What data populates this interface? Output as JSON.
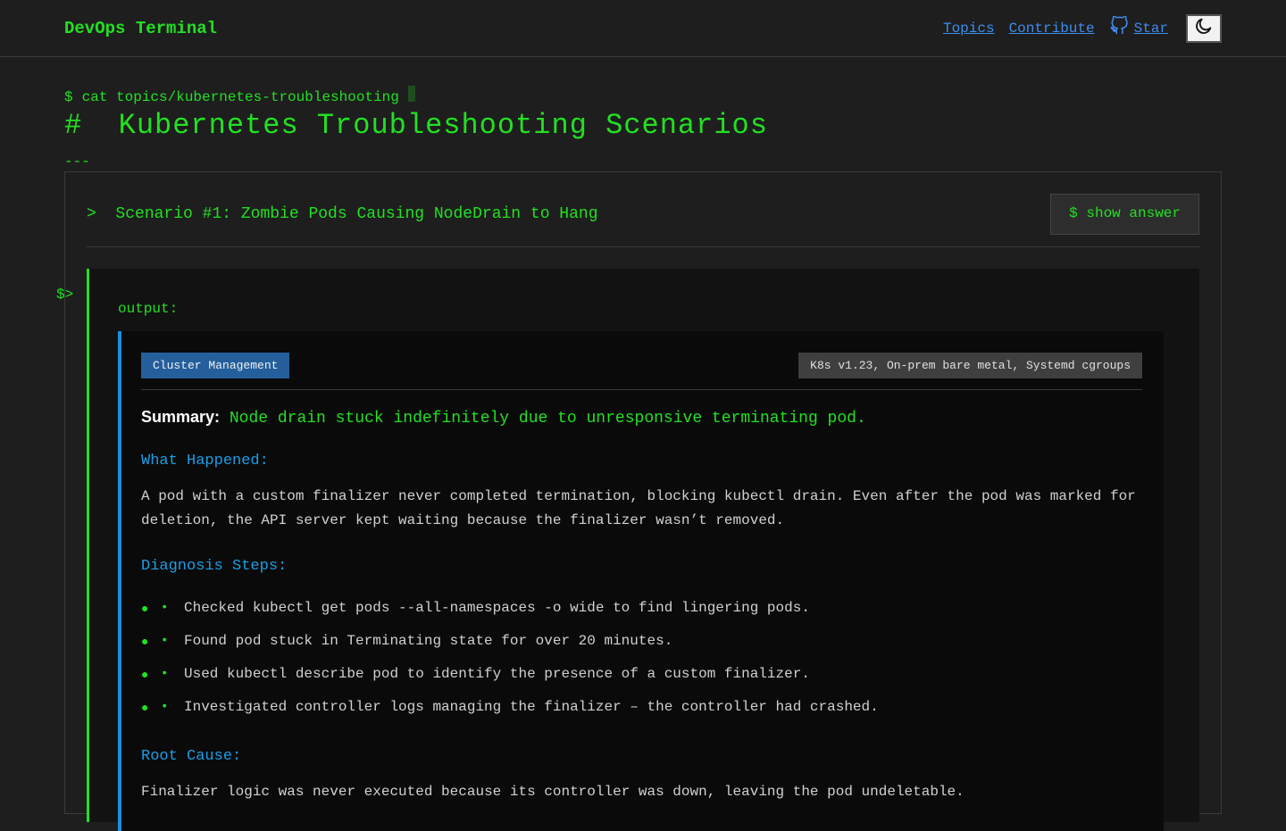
{
  "header": {
    "brand": "DevOps Terminal",
    "nav": {
      "topics": "Topics",
      "contribute": "Contribute",
      "star": "Star"
    }
  },
  "command": {
    "prompt": "$",
    "path": "cat topics/kubernetes-troubleshooting"
  },
  "page": {
    "hash": "#",
    "title": "Kubernetes Troubleshooting Scenarios",
    "rule": "---"
  },
  "scenario": {
    "marker": ">",
    "title": "Scenario #1: Zombie Pods Causing NodeDrain to Hang",
    "show_answer": "$ show answer",
    "side_prompt": "$>",
    "output_label": "output:",
    "category": "Cluster Management",
    "environment": "K8s v1.23, On-prem bare metal, Systemd cgroups",
    "summary_label": "Summary:",
    "summary": "Node drain stuck indefinitely due to unresponsive terminating pod.",
    "what_happened_heading": "What Happened:",
    "what_happened": "A pod with a custom finalizer never completed termination, blocking kubectl drain. Even after the pod was marked for deletion, the API server kept waiting because the finalizer wasn’t removed.",
    "diagnosis_heading": "Diagnosis Steps:",
    "bullet": "•",
    "steps": [
      "Checked kubectl get pods --all-namespaces -o wide to find lingering pods.",
      "Found pod stuck in Terminating state for over 20 minutes.",
      "Used kubectl describe pod to identify the presence of a custom finalizer.",
      "Investigated controller logs managing the finalizer – the controller had crashed."
    ],
    "root_cause_heading": "Root Cause:",
    "root_cause": "Finalizer logic was never executed because its controller was down, leaving the pod undeletable."
  },
  "colors": {
    "accent": "#22e022",
    "link": "#3d8df0",
    "heading": "#1a9fe8",
    "category": "#245f9c"
  },
  "icons": {
    "github": "github-icon",
    "theme": "moon-icon"
  }
}
